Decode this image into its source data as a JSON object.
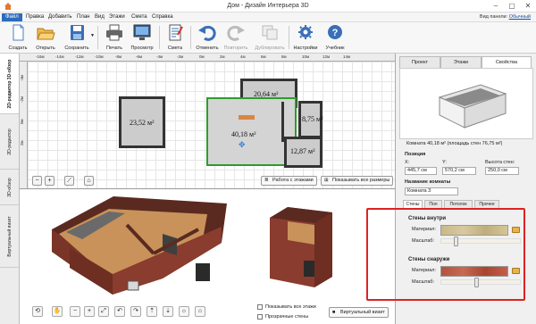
{
  "window": {
    "title": "Дом - Дизайн Интерьера 3D",
    "controls": [
      "–",
      "▢",
      "✕"
    ]
  },
  "menu": {
    "items": [
      "Файл",
      "Правка",
      "Добавить",
      "План",
      "Вид",
      "Этажи",
      "Смета",
      "Справка"
    ],
    "account_prefix": "Вид панели:",
    "account_link": "Обычный"
  },
  "toolbar": {
    "create": "Создать",
    "open": "Открыть",
    "save": "Сохранить",
    "print": "Печать",
    "preview": "Просмотр",
    "estimate": "Смета",
    "undo": "Отменить",
    "redo": "Повторить",
    "duplicate": "Дублировать",
    "settings": "Настройки",
    "tutorial": "Учебник"
  },
  "left_tabs": [
    "2D-редактор 3D-обзор",
    "2D-редактор",
    "3D-обзор",
    "Виртуальный визит"
  ],
  "ruler": {
    "top": [
      "-16м",
      "-14м",
      "-12м",
      "-10м",
      "-8м",
      "-6м",
      "-4м",
      "-2м",
      "0м",
      "2м",
      "4м",
      "6м",
      "8м",
      "10м",
      "12м",
      "14м"
    ],
    "left": [
      "-4м",
      "-2м",
      "0м",
      "2м"
    ]
  },
  "plan": {
    "rooms": [
      "23,52 м²",
      "20,64 м²",
      "40,18 м²",
      "8,75 м²",
      "12,87 м²"
    ],
    "floors_button": "Работа с этажами",
    "dimensions_button": "Показывать все размеры"
  },
  "view3d": {
    "show_all_floors": "Показывать все этажи",
    "transparent_walls": "Прозрачные стены",
    "virtual_visit": "Виртуальный визит"
  },
  "right": {
    "tabs": [
      "Проект",
      "Этажи",
      "Свойства"
    ],
    "room_caption": "Комната 40,18 м² (площадь стен 76,75 м²)",
    "position_label": "Позиция",
    "x_label": "X:",
    "x_value": "445,7 см",
    "y_label": "Y:",
    "y_value": "570,2 см",
    "h_label": "Высота стен:",
    "h_value": "250,0 см",
    "name_label": "Название комнаты",
    "name_value": "Комната 3",
    "subtabs": [
      "Стены",
      "Пол",
      "Потолок",
      "Прочее"
    ],
    "walls_inside": "Стены внутри",
    "walls_outside": "Стены снаружи",
    "material": "Материал:",
    "scale": "Масштаб:"
  },
  "colors": {
    "accent": "#2b6cbc",
    "highlight": "#d22222",
    "brick": "#b4523e",
    "wood": "#c8925a",
    "selected_room": "#2e9b2e"
  },
  "levels": {
    "inside_scale": 0.16,
    "outside_scale": 0.43
  }
}
